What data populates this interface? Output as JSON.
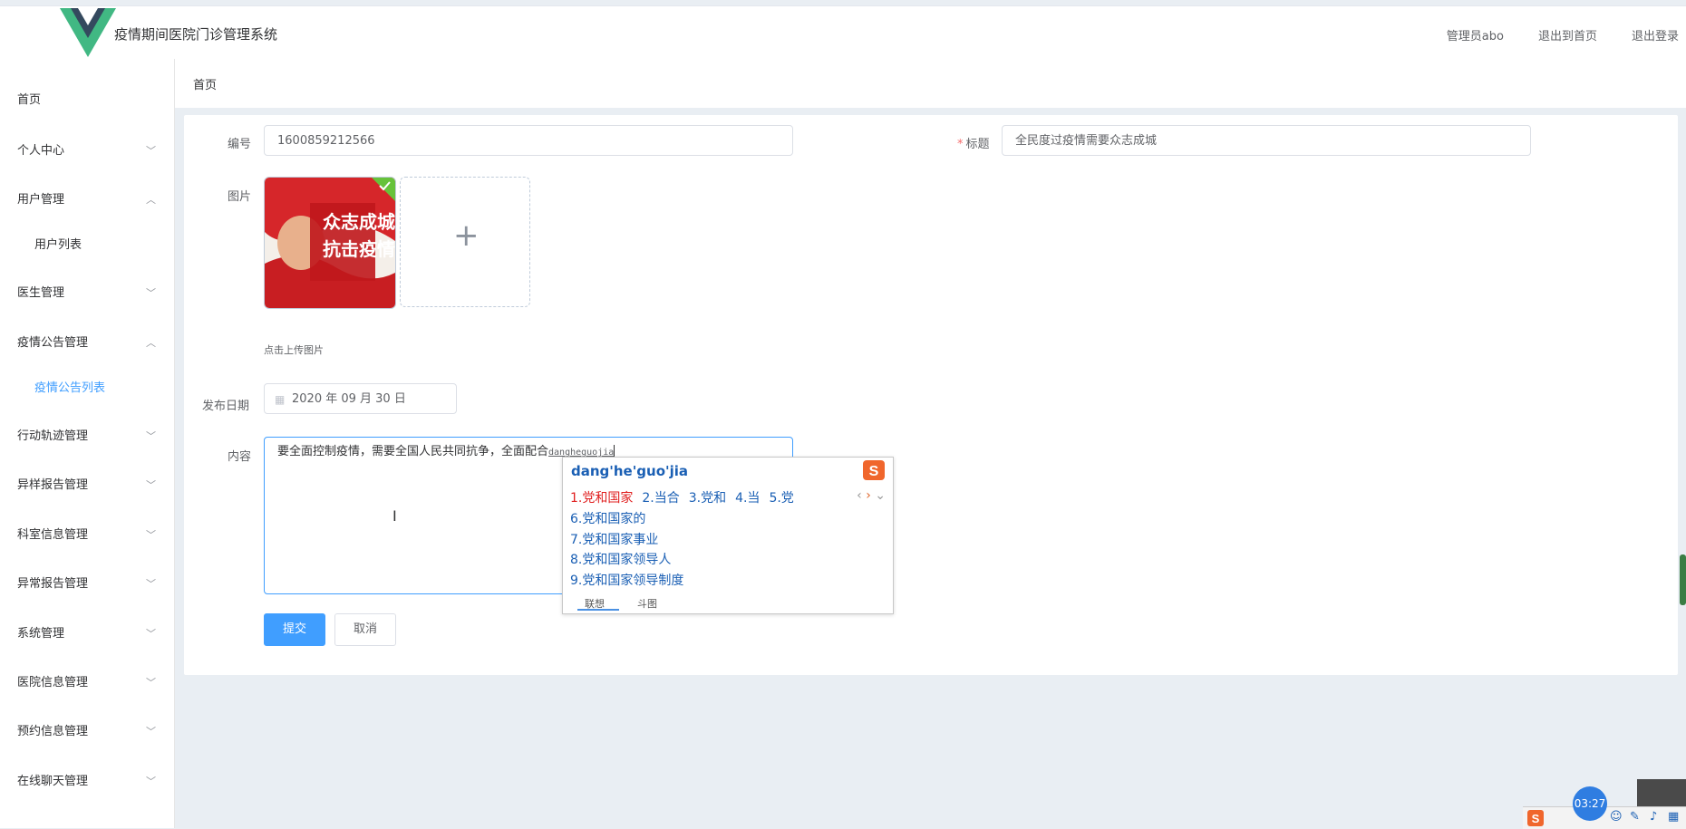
{
  "header": {
    "app_title": "疫情期间医院门诊管理系统",
    "links": [
      "管理员abo",
      "退出到首页",
      "退出登录"
    ]
  },
  "sidebar": {
    "items": [
      {
        "label": "首页"
      },
      {
        "label": "个人中心"
      },
      {
        "label": "用户管理"
      },
      {
        "label": "用户列表"
      },
      {
        "label": "医生管理"
      },
      {
        "label": "疫情公告管理"
      },
      {
        "label": "疫情公告列表"
      },
      {
        "label": "行动轨迹管理"
      },
      {
        "label": "异样报告管理"
      },
      {
        "label": "科室信息管理"
      },
      {
        "label": "异常报告管理"
      },
      {
        "label": "系统管理"
      },
      {
        "label": "医院信息管理"
      },
      {
        "label": "预约信息管理"
      },
      {
        "label": "在线聊天管理"
      }
    ]
  },
  "breadcrumb": "首页",
  "form": {
    "number_label": "编号",
    "number_value": "1600859212566",
    "title_label": "标题",
    "title_value": "全民度过疫情需要众志成城",
    "image_label": "图片",
    "image_text_line1": "众志成城",
    "image_text_line2": "抗击疫情",
    "upload_tip": "点击上传图片",
    "date_label": "发布日期",
    "date_value": "2020 年 09 月 30 日",
    "content_label": "内容",
    "content_value": "要全面控制疫情，需要全国人民共同抗争，全面配合",
    "content_pinyin": "dangheguojia",
    "submit": "提交",
    "cancel": "取消"
  },
  "ime": {
    "pinyin": "dang'he'guo'jia",
    "row1": [
      "1.党和国家",
      "2.当合",
      "3.党和",
      "4.当",
      "5.党"
    ],
    "more": [
      "6.党和国家的",
      "7.党和国家事业",
      "8.党和国家领导人",
      "9.党和国家领导制度"
    ],
    "tabs": [
      "联想",
      "斗图"
    ]
  },
  "timer": "03:27",
  "colors": {
    "primary": "#409eff",
    "ime_blue": "#1a5fb4",
    "ime_red": "#e02020"
  }
}
